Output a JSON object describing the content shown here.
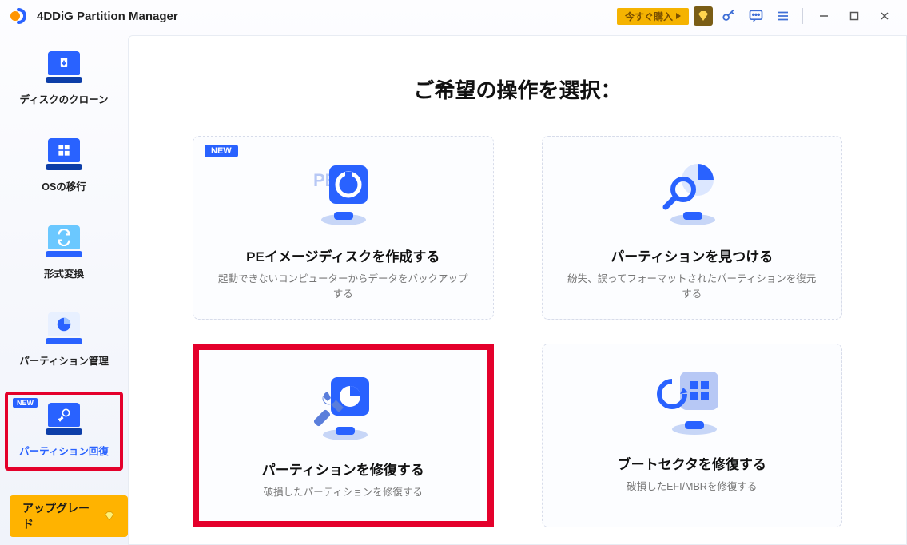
{
  "app": {
    "title": "4DDiG Partition Manager"
  },
  "titlebar": {
    "buy_now": "今すぐ購入"
  },
  "sidebar": {
    "items": [
      {
        "label": "ディスクのクローン"
      },
      {
        "label": "OSの移行"
      },
      {
        "label": "形式変換"
      },
      {
        "label": "パーティション管理"
      },
      {
        "label": "パーティション回復",
        "new": "NEW"
      }
    ],
    "upgrade": "アップグレード"
  },
  "content": {
    "heading": "ご希望の操作を選択：",
    "cards": [
      {
        "new": "NEW",
        "title": "PEイメージディスクを作成する",
        "desc": "起動できないコンピューターからデータをバックアップする"
      },
      {
        "title": "パーティションを見つける",
        "desc": "紛失、誤ってフォーマットされたパーティションを復元する"
      },
      {
        "title": "パーティションを修復する",
        "desc": "破損したパーティションを修復する"
      },
      {
        "title": "ブートセクタを修復する",
        "desc": "破損したEFI/MBRを修復する"
      }
    ]
  }
}
